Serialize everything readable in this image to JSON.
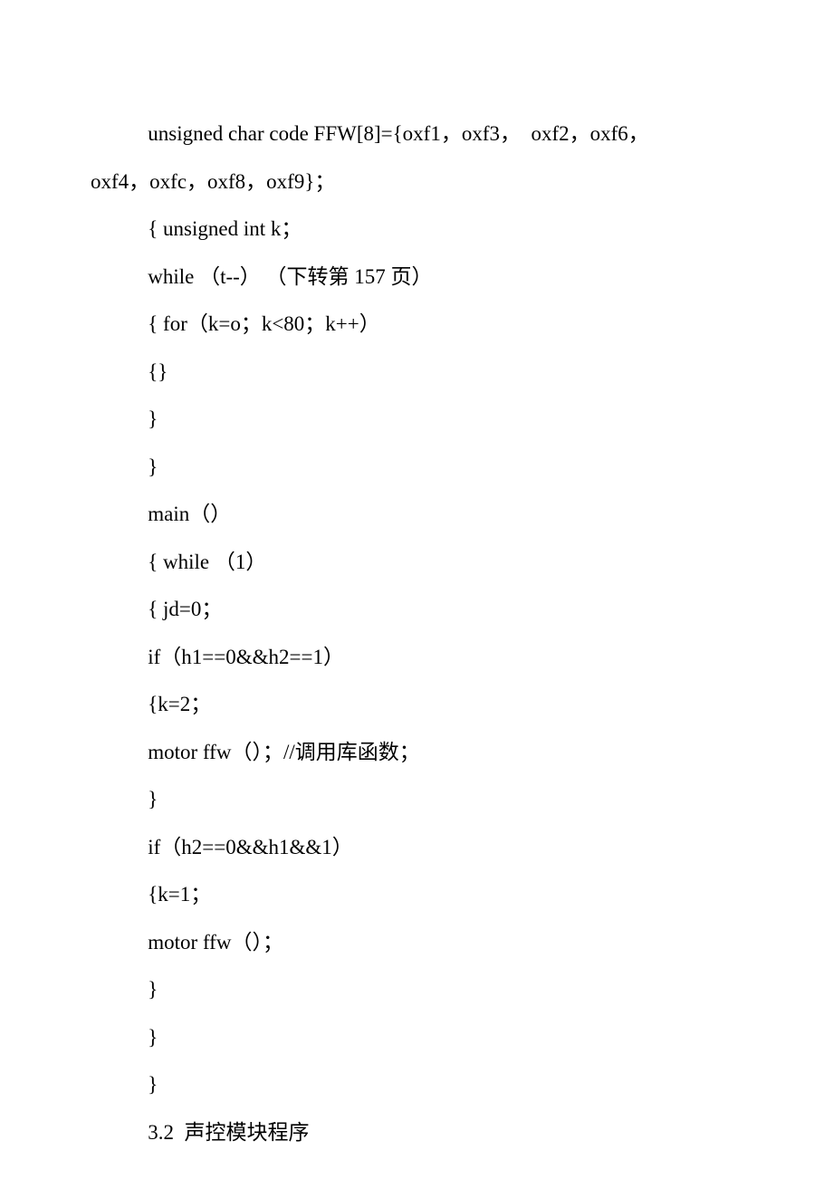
{
  "lines": [
    {
      "indent": true,
      "text": "unsigned char code FFW[8]={oxf1，oxf3，  oxf2，oxf6，"
    },
    {
      "indent": false,
      "text": "oxf4，oxfc，oxf8，oxf9}；"
    },
    {
      "indent": true,
      "text": "{ unsigned int k；"
    },
    {
      "indent": true,
      "text": "while （t--） （下转第 157 页）"
    },
    {
      "indent": true,
      "text": "{ for（k=o；k<80；k++）"
    },
    {
      "indent": true,
      "text": "{}"
    },
    {
      "indent": true,
      "text": "}"
    },
    {
      "indent": true,
      "text": "}"
    },
    {
      "indent": true,
      "text": "main（）"
    },
    {
      "indent": true,
      "text": "{ while （1）"
    },
    {
      "indent": true,
      "text": "{ jd=0；"
    },
    {
      "indent": true,
      "text": "if（h1==0&&h2==1）"
    },
    {
      "indent": true,
      "text": "{k=2；"
    },
    {
      "indent": true,
      "text": "motor ffw（）；//调用库函数；"
    },
    {
      "indent": true,
      "text": "}"
    },
    {
      "indent": true,
      "text": "if（h2==0&&h1&&1）"
    },
    {
      "indent": true,
      "text": "{k=1；"
    },
    {
      "indent": true,
      "text": "motor ffw（）；"
    },
    {
      "indent": true,
      "text": "}"
    },
    {
      "indent": true,
      "text": "}"
    },
    {
      "indent": true,
      "text": "}"
    },
    {
      "indent": true,
      "text": "3.2  声控模块程序"
    }
  ]
}
